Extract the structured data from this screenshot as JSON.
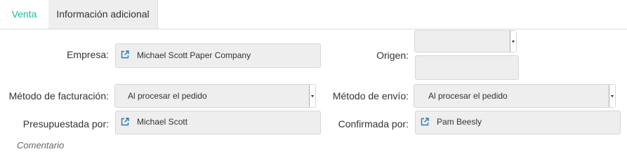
{
  "tabs": [
    {
      "label": "Venta",
      "active": false
    },
    {
      "label": "Información adicional",
      "active": true
    }
  ],
  "fields": {
    "empresa": {
      "label": "Empresa:",
      "value": "Michael Scott Paper Company"
    },
    "origen": {
      "label": "Origen:",
      "value": ""
    },
    "metodo_facturacion": {
      "label": "Método de facturación:",
      "value": "Al procesar el pedido"
    },
    "metodo_envio": {
      "label": "Método de envío:",
      "value": "Al procesar el pedido"
    },
    "presupuestada_por": {
      "label": "Presupuestada por:",
      "value": "Michael Scott"
    },
    "confirmada_por": {
      "label": "Confirmada por:",
      "value": "Pam Beesly"
    }
  },
  "comment_label": "Comentario",
  "icons": {
    "external_link": "external-link-icon",
    "dropdown": "chevron-down-icon"
  },
  "colors": {
    "active_tab_text": "#1abc9c",
    "field_bg": "#eeeeee",
    "link_icon": "#2a7ab0"
  }
}
